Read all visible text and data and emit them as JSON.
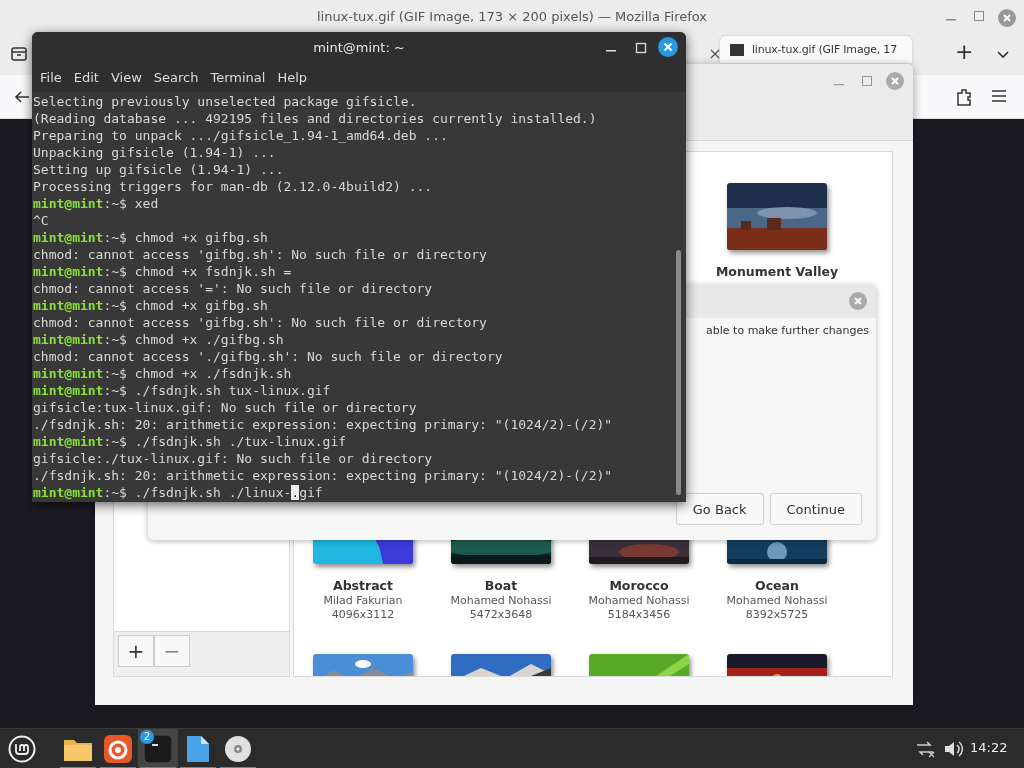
{
  "firefox": {
    "title": "linux-tux.gif (GIF Image, 173 × 200 pixels) — Mozilla Firefox",
    "tabs": [
      {
        "label": "linux-tux.gif (GIF Image, 17",
        "selected": true
      }
    ],
    "new_tab": "+"
  },
  "backgrounds": {
    "wallpapers": [
      {
        "kind": "wallpaper",
        "name": "Monument Valley"
      },
      {
        "kind": "wallpaper",
        "name": "Abstract",
        "author": "Milad Fakurian",
        "size": "4096x3112"
      },
      {
        "kind": "wallpaper",
        "name": "Boat",
        "author": "Mohamed Nohassi",
        "size": "5472x3648"
      },
      {
        "kind": "wallpaper",
        "name": "Morocco",
        "author": "Mohamed Nohassi",
        "size": "5184x3456"
      },
      {
        "kind": "wallpaper",
        "name": "Ocean",
        "author": "Mohamed Nohassi",
        "size": "8392x5725"
      },
      {
        "kind": "picture"
      },
      {
        "kind": "picture"
      },
      {
        "kind": "picture"
      },
      {
        "kind": "picture"
      }
    ],
    "add": "+",
    "remove": "−"
  },
  "dialog": {
    "message": "able to make further changes",
    "buttons": [
      "Go Back",
      "Continue"
    ]
  },
  "terminal": {
    "title": "mint@mint: ~",
    "menu": [
      "File",
      "Edit",
      "View",
      "Search",
      "Terminal",
      "Help"
    ],
    "lines": [
      {
        "kind": "output",
        "text": "Selecting previously unselected package gifsicle."
      },
      {
        "kind": "output",
        "text": "(Reading database ... 492195 files and directories currently installed.)"
      },
      {
        "kind": "output",
        "text": "Preparing to unpack .../gifsicle_1.94-1_amd64.deb ..."
      },
      {
        "kind": "output",
        "text": "Unpacking gifsicle (1.94-1) ..."
      },
      {
        "kind": "output",
        "text": "Setting up gifsicle (1.94-1) ..."
      },
      {
        "kind": "output",
        "text": "Processing triggers for man-db (2.12.0-4build2) ..."
      },
      {
        "kind": "prompt",
        "user": "mint@mint",
        "tail": ":~$",
        "command": "xed"
      },
      {
        "kind": "output",
        "text": "^C"
      },
      {
        "kind": "prompt",
        "user": "mint@mint",
        "tail": ":~$",
        "command": "chmod +x gifbg.sh"
      },
      {
        "kind": "output",
        "text": "chmod: cannot access 'gifbg.sh': No such file or directory"
      },
      {
        "kind": "prompt",
        "user": "mint@mint",
        "tail": ":~$",
        "command": "chmod +x fsdnjk.sh ="
      },
      {
        "kind": "output",
        "text": "chmod: cannot access '=': No such file or directory"
      },
      {
        "kind": "prompt",
        "user": "mint@mint",
        "tail": ":~$",
        "command": "chmod +x gifbg.sh"
      },
      {
        "kind": "output",
        "text": "chmod: cannot access 'gifbg.sh': No such file or directory"
      },
      {
        "kind": "prompt",
        "user": "mint@mint",
        "tail": ":~$",
        "command": "chmod +x ./gifbg.sh"
      },
      {
        "kind": "output",
        "text": "chmod: cannot access './gifbg.sh': No such file or directory"
      },
      {
        "kind": "prompt",
        "user": "mint@mint",
        "tail": ":~$",
        "command": "chmod +x ./fsdnjk.sh"
      },
      {
        "kind": "prompt",
        "user": "mint@mint",
        "tail": ":~$",
        "command": "./fsdnjk.sh tux-linux.gif"
      },
      {
        "kind": "output",
        "text": "gifsicle:tux-linux.gif: No such file or directory"
      },
      {
        "kind": "output",
        "text": "./fsdnjk.sh: 20: arithmetic expression: expecting primary: \"(1024/2)-(/2)\""
      },
      {
        "kind": "prompt",
        "user": "mint@mint",
        "tail": ":~$",
        "command": "./fsdnjk.sh ./tux-linux.gif"
      },
      {
        "kind": "output",
        "text": "gifsicle:./tux-linux.gif: No such file or directory"
      },
      {
        "kind": "output",
        "text": "./fsdnjk.sh: 20: arithmetic expression: expecting primary: \"(1024/2)-(/2)\""
      },
      {
        "kind": "prompt",
        "user": "mint@mint",
        "tail": ":~$",
        "command": "./fsdnjk.sh ./linux-",
        "cursor": ".",
        "after": "gif"
      }
    ]
  },
  "taskbar": {
    "apps": [
      {
        "kind": "folder",
        "selected": false,
        "running": true
      },
      {
        "kind": "firefox",
        "selected": false,
        "running": true
      },
      {
        "kind": "terminal",
        "selected": true,
        "running": true,
        "badge": "2"
      },
      {
        "kind": "document",
        "selected": false,
        "running": true
      },
      {
        "kind": "disc",
        "selected": false,
        "running": true
      }
    ],
    "clock": "14:22"
  }
}
